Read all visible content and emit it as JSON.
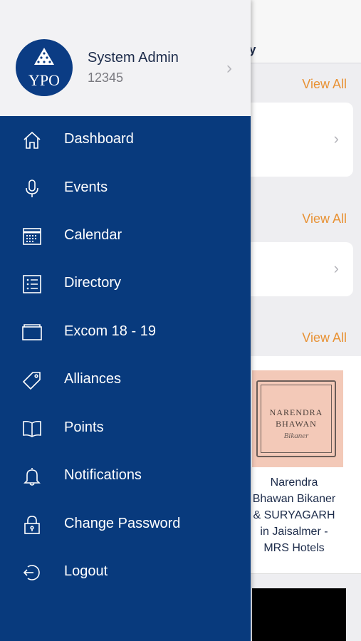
{
  "background": {
    "header_title": "y",
    "sections": [
      {
        "view_all": "View All"
      },
      {
        "view_all": "View All"
      },
      {
        "view_all": "View All"
      }
    ],
    "hotel": {
      "logo_line1": "NARENDRA",
      "logo_line2": "BHAWAN",
      "logo_line3": "Bikaner",
      "title_lines": [
        "Narendra",
        "Bhawan Bikaner",
        "& SURYAGARH",
        "in Jaisalmer -",
        "MRS Hotels"
      ]
    }
  },
  "profile": {
    "avatar_text": "YPO",
    "name": "System Admin",
    "id": "12345"
  },
  "menu": [
    {
      "label": "Dashboard",
      "icon": "home-icon"
    },
    {
      "label": "Events",
      "icon": "microphone-icon"
    },
    {
      "label": "Calendar",
      "icon": "calendar-icon"
    },
    {
      "label": "Directory",
      "icon": "list-icon"
    },
    {
      "label": "Excom 18 - 19",
      "icon": "folder-icon"
    },
    {
      "label": "Alliances",
      "icon": "tag-icon"
    },
    {
      "label": "Points",
      "icon": "book-icon"
    },
    {
      "label": "Notifications",
      "icon": "bell-icon"
    },
    {
      "label": "Change Password",
      "icon": "lock-icon"
    },
    {
      "label": "Logout",
      "icon": "logout-icon"
    }
  ],
  "colors": {
    "drawer": "#083a7d",
    "accent": "#e89235",
    "profile_bg": "#f2f2f4"
  }
}
